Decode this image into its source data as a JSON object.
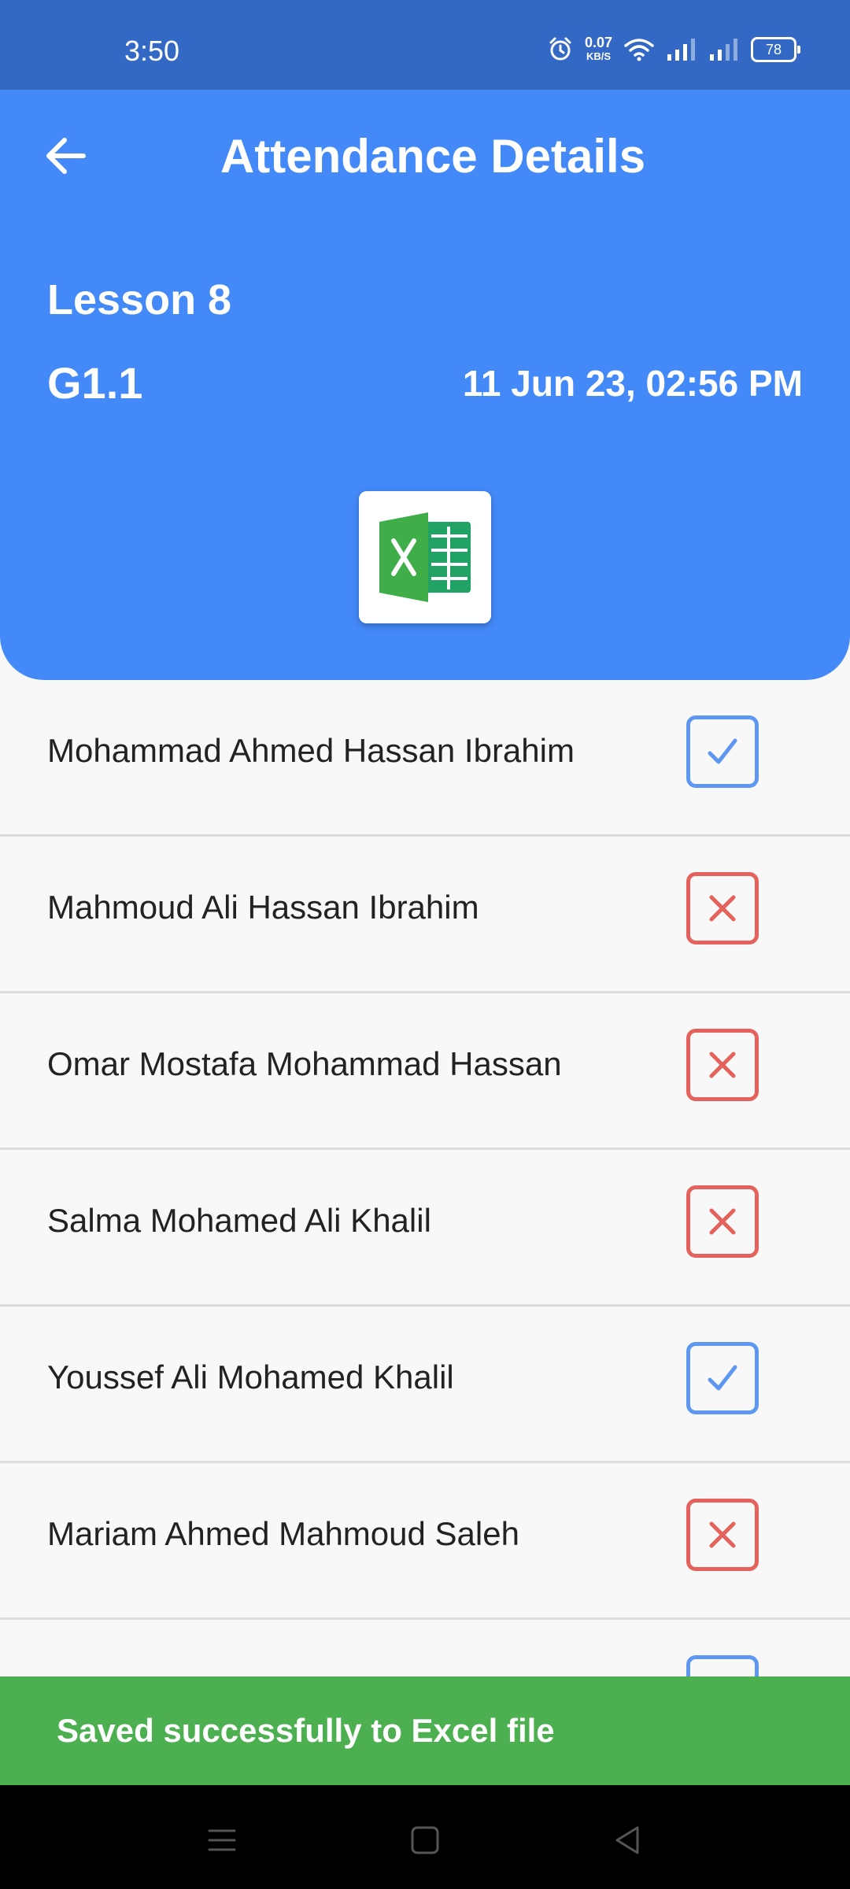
{
  "status_bar": {
    "time": "3:50",
    "net_speed_value": "0.07",
    "net_speed_unit": "KB/S",
    "battery": "78",
    "icons": [
      "alarm-icon",
      "wifi-icon",
      "signal-icon",
      "signal-icon-2",
      "battery-icon"
    ]
  },
  "header": {
    "title": "Attendance Details",
    "back_icon": "arrow-left-icon",
    "lesson": "Lesson 8",
    "group": "G1.1",
    "datetime": "11 Jun 23, 02:56 PM",
    "export_icon": "excel-icon"
  },
  "students": [
    {
      "name": "Mohammad Ahmed Hassan Ibrahim",
      "status": "present"
    },
    {
      "name": "Mahmoud Ali Hassan Ibrahim",
      "status": "absent"
    },
    {
      "name": "Omar Mostafa Mohammad Hassan",
      "status": "absent"
    },
    {
      "name": "Salma Mohamed Ali Khalil",
      "status": "absent"
    },
    {
      "name": "Youssef Ali Mohamed Khalil",
      "status": "present"
    },
    {
      "name": "Mariam Ahmed Mahmoud Saleh",
      "status": "absent"
    },
    {
      "name": "",
      "status": "present"
    }
  ],
  "snackbar": {
    "message": "Saved successfully to Excel file"
  },
  "colors": {
    "status_bar": "#3368c4",
    "header": "#4489f8",
    "present": "#5e97f2",
    "absent": "#e4625b",
    "snackbar": "#4caf50"
  },
  "nav_bar": {
    "icons": [
      "menu-icon",
      "home-icon",
      "back-icon"
    ]
  }
}
